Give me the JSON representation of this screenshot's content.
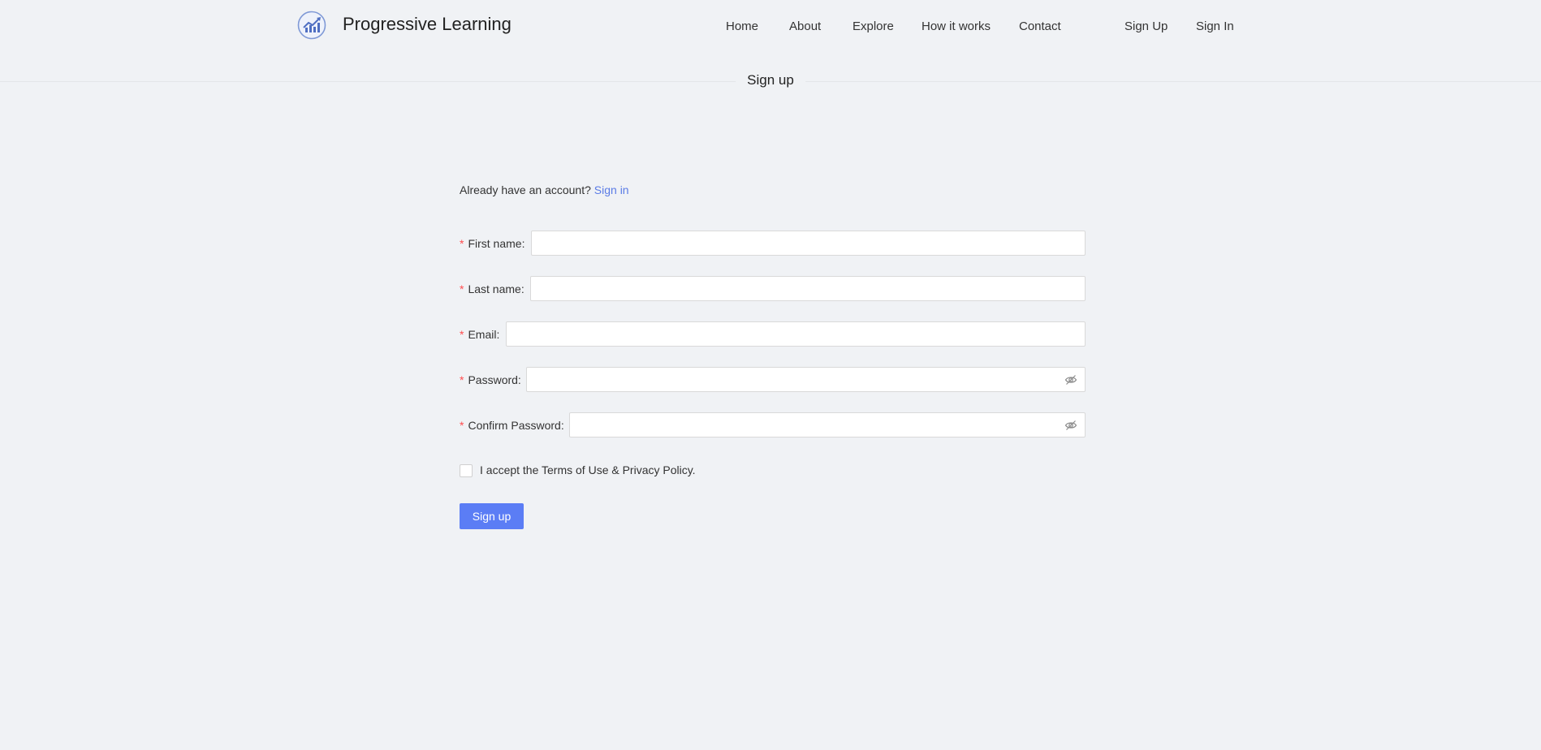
{
  "header": {
    "brand": "Progressive Learning",
    "logo_icon": "chart-growth-icon",
    "nav": [
      {
        "id": "home",
        "label": "Home"
      },
      {
        "id": "about",
        "label": "About"
      },
      {
        "id": "explore",
        "label": "Explore"
      },
      {
        "id": "how-it-works",
        "label": "How it works"
      },
      {
        "id": "contact",
        "label": "Contact"
      }
    ],
    "auth": [
      {
        "id": "sign-up",
        "label": "Sign Up"
      },
      {
        "id": "sign-in",
        "label": "Sign In"
      }
    ]
  },
  "page": {
    "title": "Sign up"
  },
  "form": {
    "already_text": "Already have an account?",
    "signin_link": "Sign in",
    "required_mark": "*",
    "fields": {
      "first_name": {
        "label": "First name:",
        "value": ""
      },
      "last_name": {
        "label": "Last name:",
        "value": ""
      },
      "email": {
        "label": "Email:",
        "value": ""
      },
      "password": {
        "label": "Password:",
        "value": ""
      },
      "confirm_password": {
        "label": "Confirm Password:",
        "value": ""
      }
    },
    "terms": {
      "label": "I accept the Terms of Use & Privacy Policy.",
      "checked": false
    },
    "submit_label": "Sign up"
  },
  "colors": {
    "background": "#f0f2f5",
    "accent": "#5b7df5",
    "link": "#5b7ce6",
    "required": "#ff4d4f"
  }
}
